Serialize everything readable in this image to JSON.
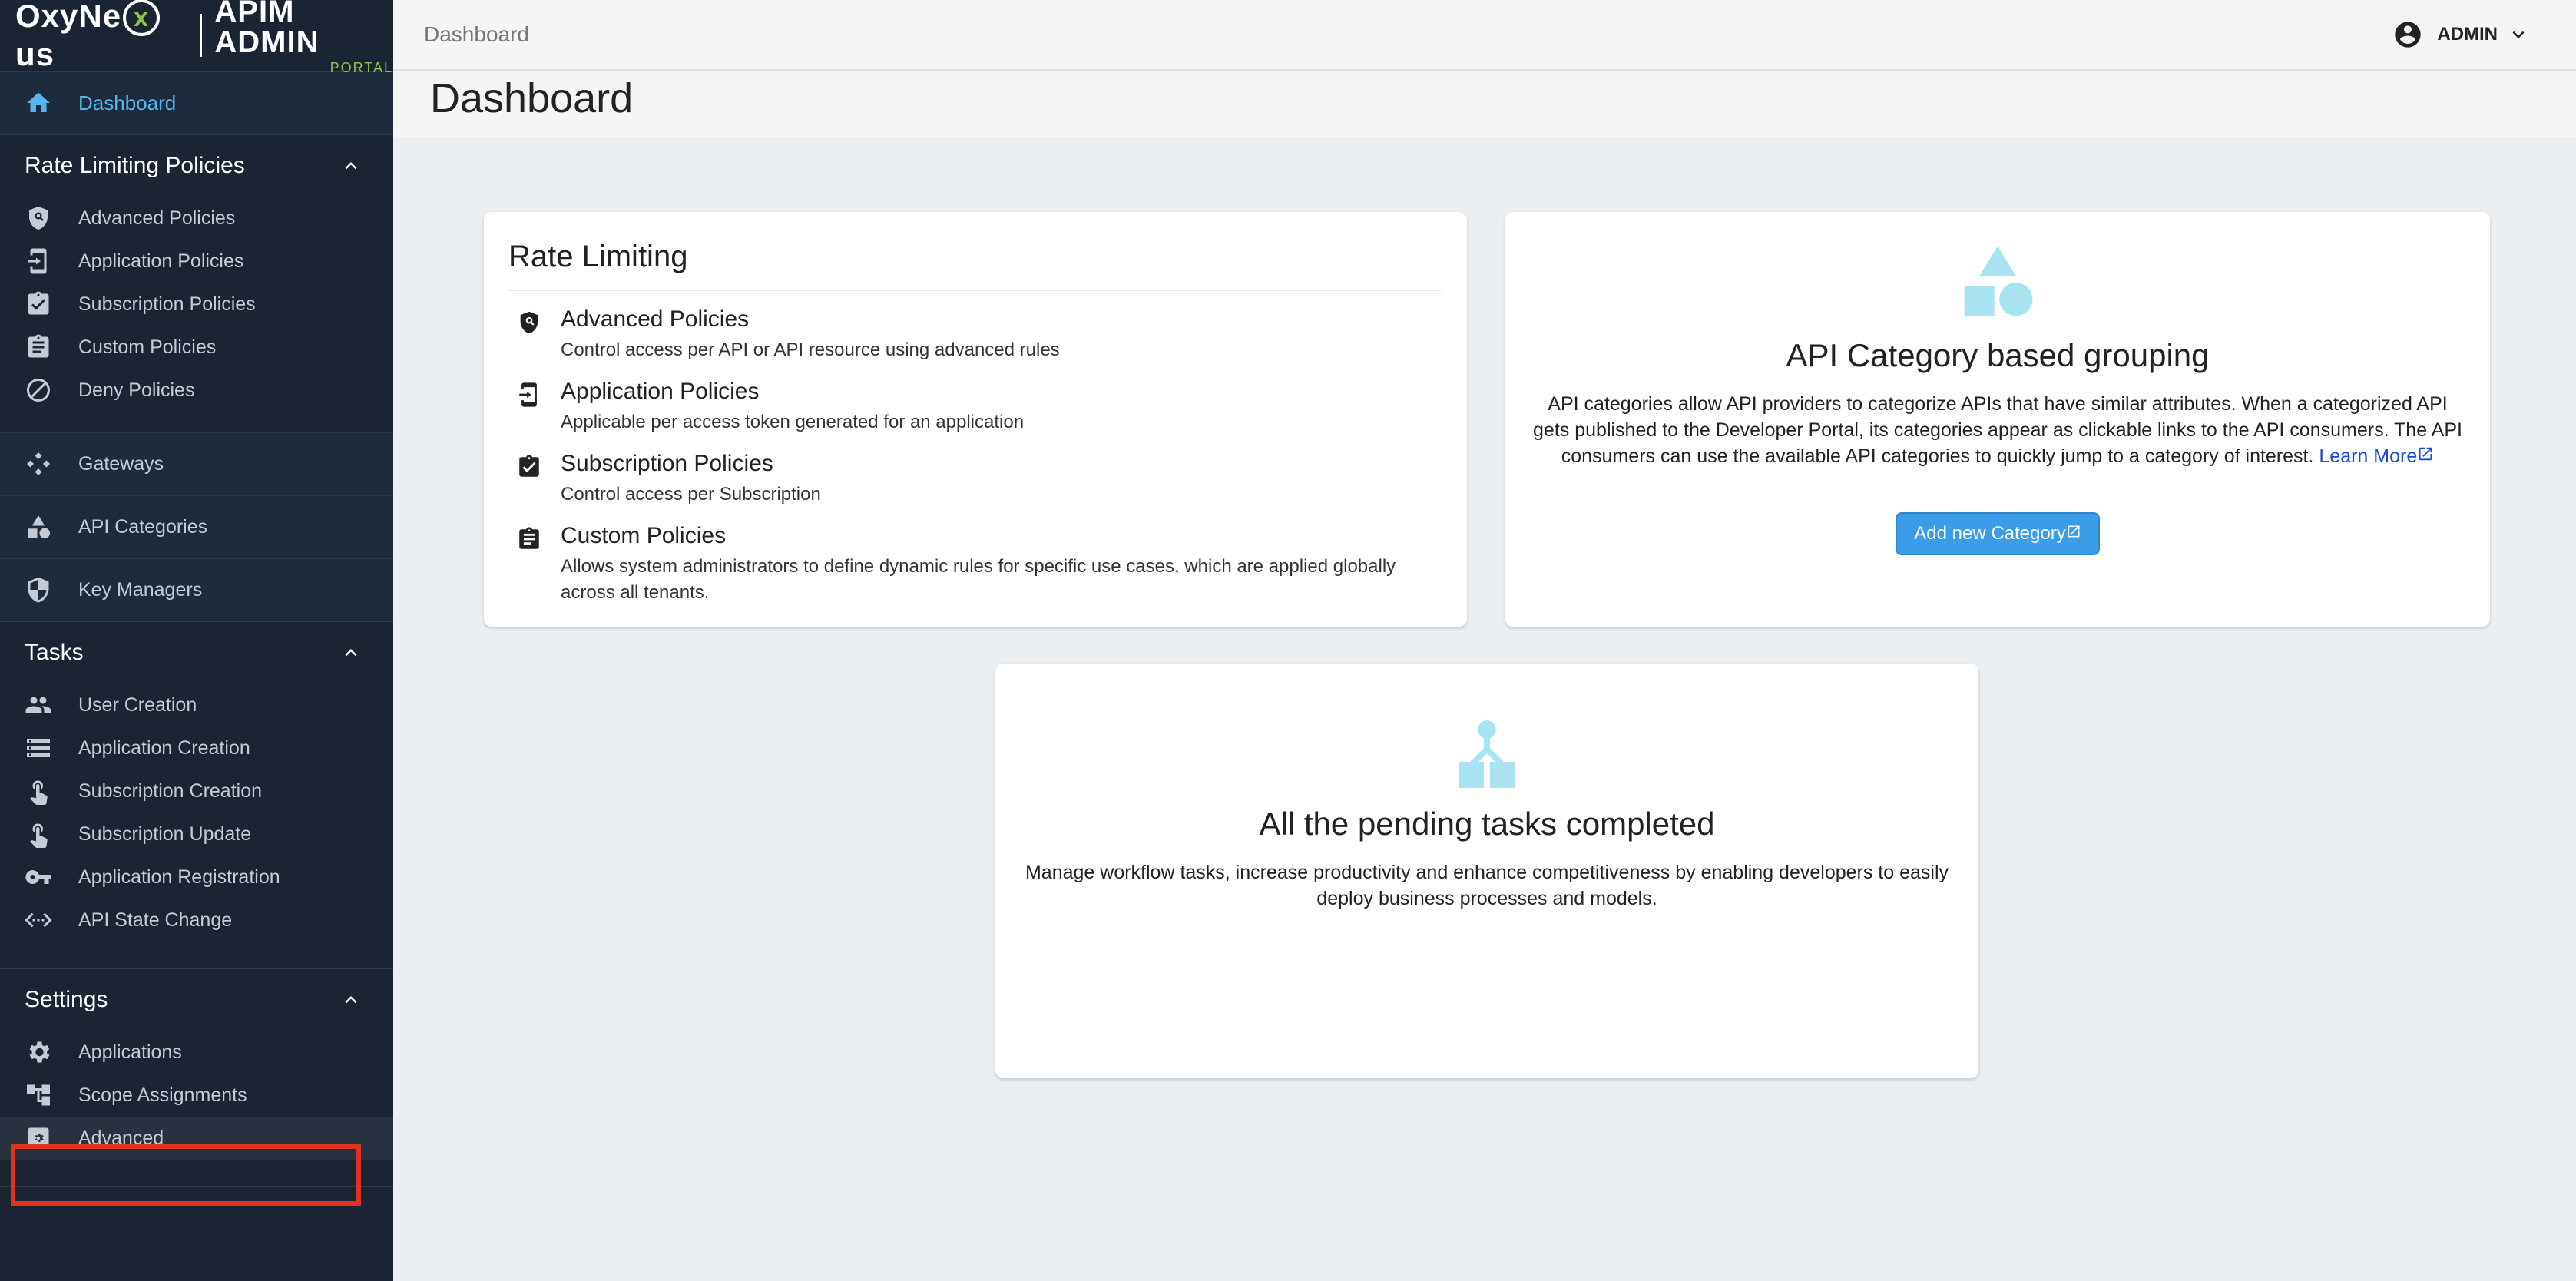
{
  "logo": {
    "word_before": "OxyNe",
    "word_x": "x",
    "word_after": "us",
    "admin": "APIM ADMIN",
    "portal": "PORTAL"
  },
  "nav": {
    "dashboard": "Dashboard"
  },
  "sidebar": {
    "rate_limiting": {
      "title": "Rate Limiting Policies",
      "items": [
        "Advanced Policies",
        "Application Policies",
        "Subscription Policies",
        "Custom Policies",
        "Deny Policies"
      ]
    },
    "gateways": "Gateways",
    "api_categories": "API Categories",
    "key_managers": "Key Managers",
    "tasks": {
      "title": "Tasks",
      "items": [
        "User Creation",
        "Application Creation",
        "Subscription Creation",
        "Subscription Update",
        "Application Registration",
        "API State Change"
      ]
    },
    "settings": {
      "title": "Settings",
      "items": [
        "Applications",
        "Scope Assignments",
        "Advanced"
      ]
    }
  },
  "topbar": {
    "breadcrumb": "Dashboard",
    "user": "ADMIN"
  },
  "page": {
    "title": "Dashboard"
  },
  "rate_card": {
    "title": "Rate Limiting",
    "items": [
      {
        "title": "Advanced Policies",
        "desc": "Control access per API or API resource using advanced rules"
      },
      {
        "title": "Application Policies",
        "desc": "Applicable per access token generated for an application"
      },
      {
        "title": "Subscription Policies",
        "desc": "Control access per Subscription"
      },
      {
        "title": "Custom Policies",
        "desc": "Allows system administrators to define dynamic rules for specific use cases, which are applied globally across all tenants."
      }
    ]
  },
  "category_card": {
    "title": "API Category based grouping",
    "desc": "API categories allow API providers to categorize APIs that have similar attributes. When a categorized API gets published to the Developer Portal, its categories appear as clickable links to the API consumers. The API consumers can use the available API categories to quickly jump to a category of interest.",
    "learn_more": "Learn More",
    "button": "Add new Category"
  },
  "task_card": {
    "title": "All the pending tasks completed",
    "desc": "Manage workflow tasks, increase productivity and enhance competitiveness by enabling developers to easily deploy business processes and models."
  },
  "colors": {
    "sidebar_bg": "#1a2433",
    "accent": "#56b5f0",
    "button": "#3b9de8",
    "highlight": "#e0321e",
    "illustration": "#a8e4ef"
  }
}
